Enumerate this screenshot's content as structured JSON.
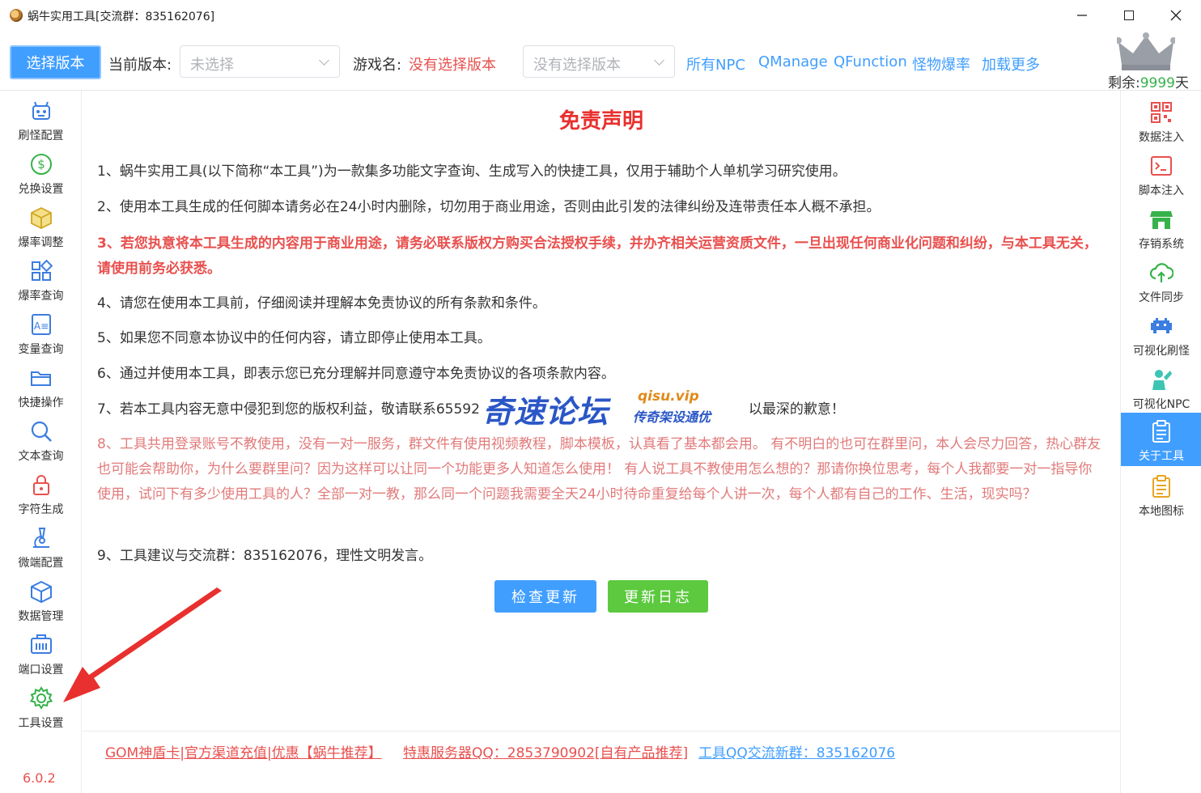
{
  "window": {
    "title": "蜗牛实用工具[交流群：835162076]"
  },
  "toolbar": {
    "select_version_label": "选择版本",
    "current_version_label": "当前版本:",
    "current_version_placeholder": "未选择",
    "game_name_label": "游戏名:",
    "game_name_value": "没有选择版本",
    "game_select_placeholder": "没有选择版本",
    "links": [
      "所有NPC",
      "QManage",
      "QFunction",
      "怪物爆率",
      "加载更多"
    ],
    "remaining_label": "剩余:",
    "remaining_value": "9999",
    "remaining_unit": "天"
  },
  "sidebar_left": {
    "items": [
      {
        "label": "刷怪配置",
        "icon": "robot-icon"
      },
      {
        "label": "兑换设置",
        "icon": "dollar-icon"
      },
      {
        "label": "爆率调整",
        "icon": "cube-icon"
      },
      {
        "label": "爆率查询",
        "icon": "grid-icon"
      },
      {
        "label": "变量查询",
        "icon": "variable-icon"
      },
      {
        "label": "快捷操作",
        "icon": "folder-icon"
      },
      {
        "label": "文本查询",
        "icon": "search-icon"
      },
      {
        "label": "字符生成",
        "icon": "lock-icon"
      },
      {
        "label": "微端配置",
        "icon": "microscope-icon"
      },
      {
        "label": "数据管理",
        "icon": "box-icon"
      },
      {
        "label": "端口设置",
        "icon": "port-icon"
      },
      {
        "label": "工具设置",
        "icon": "gear-icon"
      }
    ],
    "version": "6.0.2"
  },
  "sidebar_right": {
    "items": [
      {
        "label": "数据注入",
        "icon": "qrcode-icon"
      },
      {
        "label": "脚本注入",
        "icon": "terminal-icon"
      },
      {
        "label": "存销系统",
        "icon": "store-icon"
      },
      {
        "label": "文件同步",
        "icon": "cloud-sync-icon"
      },
      {
        "label": "可视化刷怪",
        "icon": "invader-icon"
      },
      {
        "label": "可视化NPC",
        "icon": "npc-icon"
      },
      {
        "label": "关于工具",
        "icon": "clipboard-icon"
      },
      {
        "label": "本地图标",
        "icon": "notepad-icon"
      }
    ]
  },
  "main": {
    "title": "免责声明",
    "paragraphs": [
      "1、蜗牛实用工具(以下简称“本工具”)为一款集多功能文字查询、生成写入的快捷工具，仅用于辅助个人单机学习研究使用。",
      "2、使用本工具生成的任何脚本请务必在24小时内删除，切勿用于商业用途，否则由此引发的法律纠纷及连带责任本人概不承担。",
      "3、若您执意将本工具生成的内容用于商业用途，请务必联系版权方购买合法授权手续，并办齐相关运营资质文件，一旦出现任何商业化问题和纠纷，与本工具无关，请使用前务必获悉。",
      "4、请您在使用本工具前，仔细阅读并理解本免责协议的所有条款和条件。",
      "5、如果您不同意本协议中的任何内容，请立即停止使用本工具。",
      "6、通过并使用本工具，即表示您已充分理解并同意遵守本免责协议的各项条款内容。",
      "7、若本工具内容无意中侵犯到您的版权利益，敬请联系65592",
      "8、工具共用登录账号不教使用，没有一对一服务，群文件有使用视频教程，脚本模板，认真看了基本都会用。 有不明白的也可在群里问，本人会尽力回答，热心群友也可能会帮助你，为什么要群里问？因为这样可以让同一个功能更多人知道怎么使用！ 有人说工具不教使用怎么想的？那请你换位思考，每个人我都要一对一指导你使用，试问下有多少使用工具的人？全部一对一教，那么同一个问题我需要全天24小时待命重复给每个人讲一次，每个人都有自己的工作、生活，现实吗？",
      "9、工具建议与交流群：835162076，理性文明发言。"
    ],
    "para7_tail": "以最深的歉意！",
    "check_update_label": "检查更新",
    "changelog_label": "更新日志"
  },
  "watermark": {
    "main": "奇速论坛",
    "url": "qisu.vip",
    "sub": "传奇架设通优"
  },
  "footer": {
    "links": [
      "GOM神盾卡|官方渠道充值|优惠【蜗牛推荐】",
      "特惠服务器QQ：2853790902[自有产品推荐]",
      "工具QQ交流新群：835162076"
    ]
  },
  "colors": {
    "accent": "#409eff",
    "danger": "#e8504e",
    "success": "#5cc93f"
  }
}
